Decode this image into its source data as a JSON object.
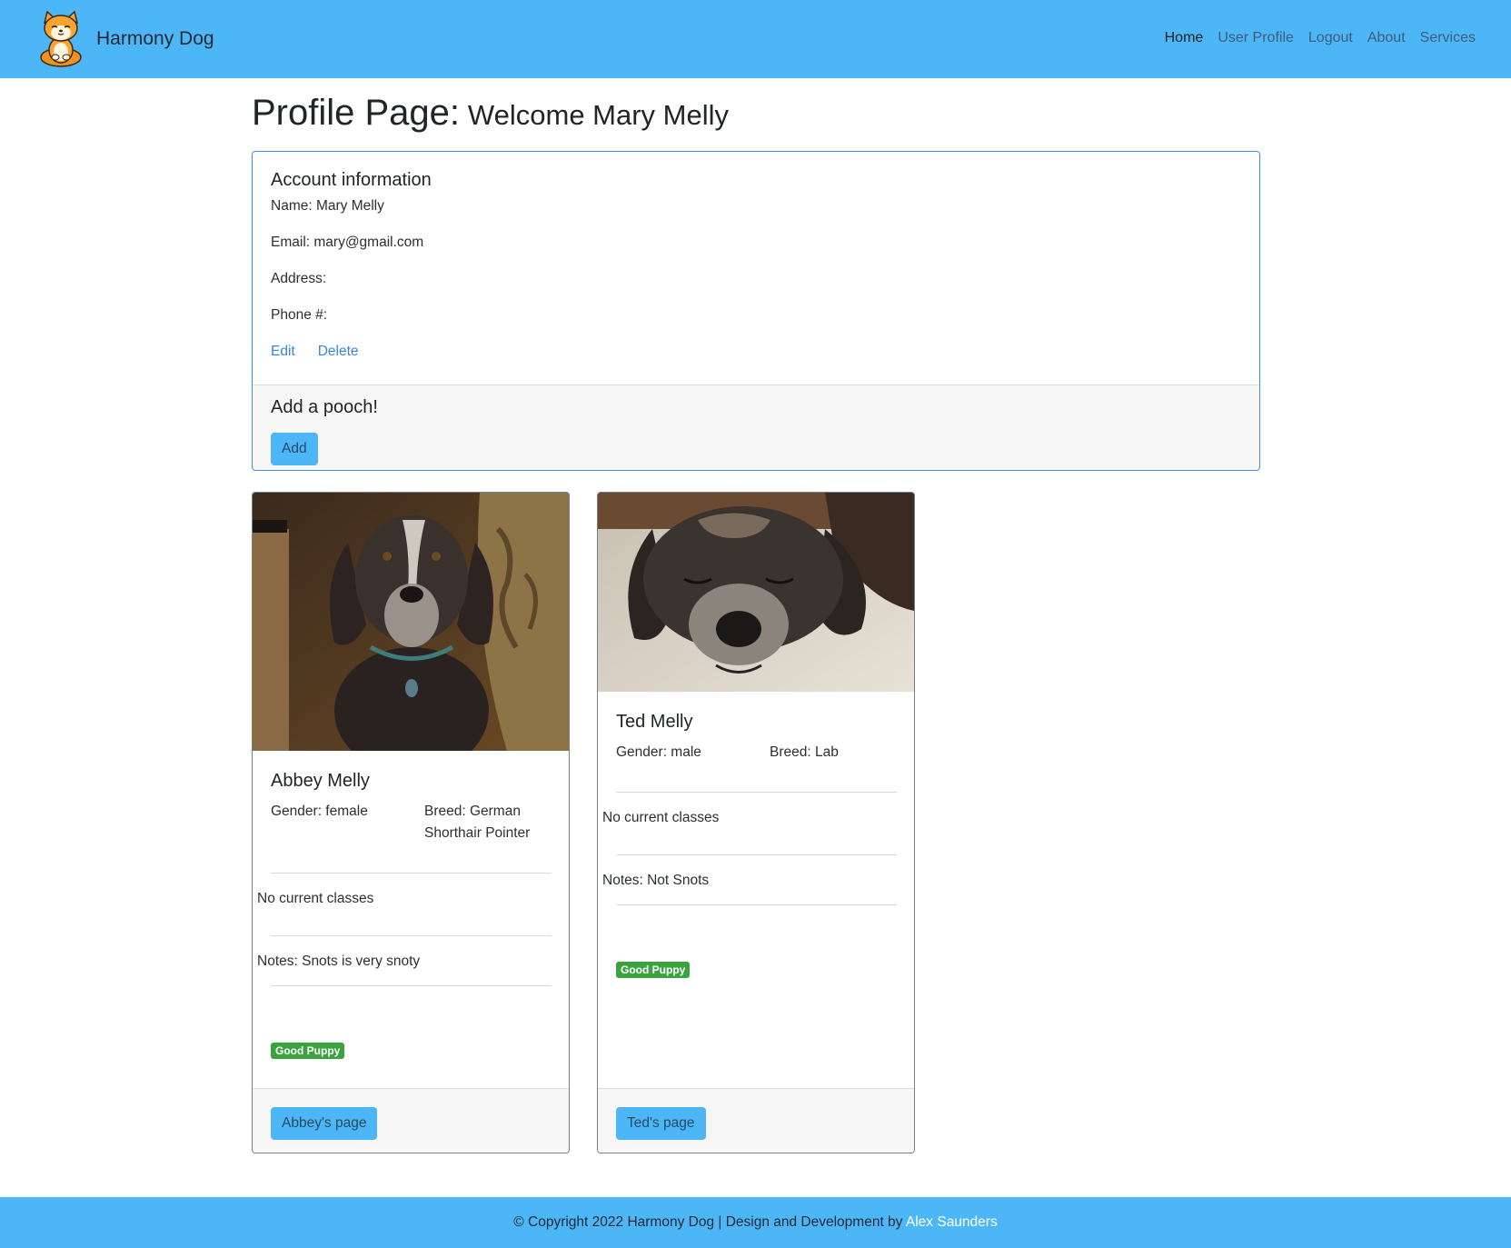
{
  "nav": {
    "brand_name": "Harmony Dog",
    "links": [
      "Home",
      "User Profile",
      "Logout",
      "About",
      "Services"
    ],
    "active": "Home"
  },
  "page": {
    "title": "Profile Page:",
    "subtitle": "Welcome Mary Melly"
  },
  "account": {
    "heading": "Account information",
    "name": "Name: Mary Melly",
    "email": "Email: mary@gmail.com",
    "address": "Address:",
    "phone": "Phone #:",
    "edit_label": "Edit",
    "delete_label": "Delete"
  },
  "add_pooch": {
    "heading": "Add a pooch!",
    "button_label": "Add"
  },
  "dogs": [
    {
      "name": "Abbey Melly",
      "gender": "Gender: female",
      "breed": "Breed: German Shorthair Pointer",
      "classes": "No current classes",
      "notes": "Notes: Snots is very snoty",
      "badge": "Good Puppy",
      "button_label": "Abbey's page"
    },
    {
      "name": "Ted Melly",
      "gender": "Gender: male",
      "breed": "Breed: Lab",
      "classes": "No current classes",
      "notes": "Notes: Not Snots",
      "badge": "Good Puppy",
      "button_label": "Ted's page"
    }
  ],
  "footer": {
    "text": "© Copyright 2022 Harmony Dog | Design and Development by",
    "author": "Alex Saunders"
  },
  "colors": {
    "primary": "#4db6f7",
    "link": "#3a84d8",
    "badge": "#3aa33f",
    "card_border": "#3c8fe3"
  }
}
